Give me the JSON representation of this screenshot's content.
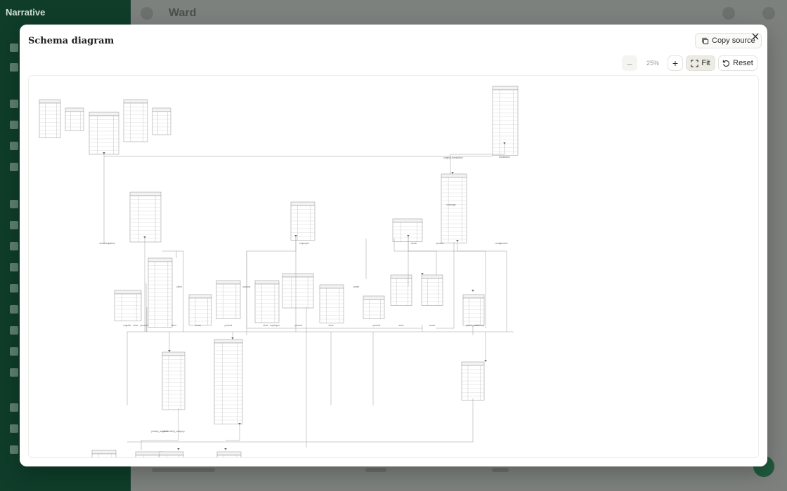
{
  "background": {
    "sidebar_brand": "Narrative",
    "workspace_title": "Ward"
  },
  "modal": {
    "title": "Schema diagram",
    "copy_label": "Copy source",
    "close_icon": "close-icon"
  },
  "toolbar": {
    "zoom_out": "–",
    "zoom_level": "25%",
    "zoom_in": "+",
    "fit_label": "Fit",
    "reset_label": "Reset"
  },
  "colors": {
    "accent_sidebar": "#0f3d2a",
    "fit_active": "#ecebe4",
    "diagram_line": "#9a9a9a"
  },
  "diagram": {
    "edge_labels": [
      "original_transaction",
      "transaction",
      "coverage",
      "owner",
      "product",
      "merchant",
      "partner",
      "employee",
      "owner",
      "product",
      "client",
      "product",
      "owner",
      "supplier",
      "store",
      "product",
      "client",
      "owner",
      "product",
      "store",
      "employee",
      "product",
      "store",
      "product",
      "store",
      "owner",
      "parent_store",
      "delivery",
      "primary_supplier",
      "membership_category"
    ]
  }
}
